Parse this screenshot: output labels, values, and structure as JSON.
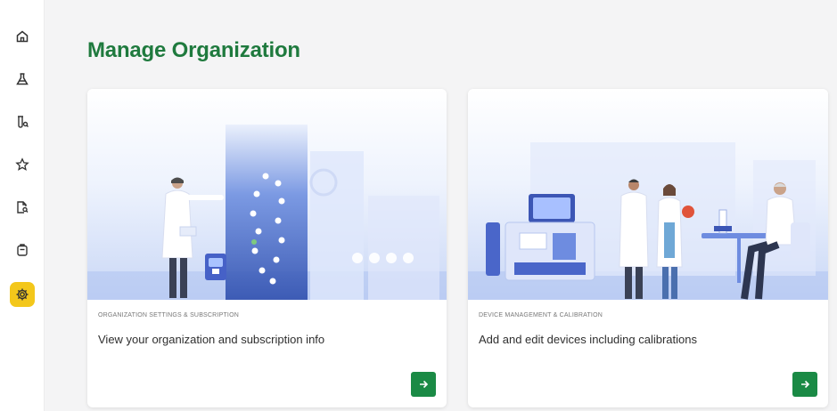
{
  "sidebar": {
    "items": [
      {
        "icon": "home-icon",
        "active": false
      },
      {
        "icon": "flask-icon",
        "active": false
      },
      {
        "icon": "test-search-icon",
        "active": false
      },
      {
        "icon": "star-icon",
        "active": false
      },
      {
        "icon": "report-search-icon",
        "active": false
      },
      {
        "icon": "clipboard-icon",
        "active": false
      },
      {
        "icon": "gear-icon",
        "active": true
      }
    ],
    "accent": "#f3c71b"
  },
  "page": {
    "title": "Manage Organization",
    "title_color": "#1f7a3e"
  },
  "cards": [
    {
      "eyebrow": "ORGANIZATION SETTINGS & SUBSCRIPTION",
      "description": "View your organization and subscription info",
      "button_icon": "arrow-right-icon"
    },
    {
      "eyebrow": "DEVICE MANAGEMENT & CALIBRATION",
      "description": "Add and edit devices including calibrations",
      "button_icon": "arrow-right-icon"
    }
  ],
  "colors": {
    "button": "#1a8a45",
    "illustration_blue": "#5b7fd8"
  }
}
